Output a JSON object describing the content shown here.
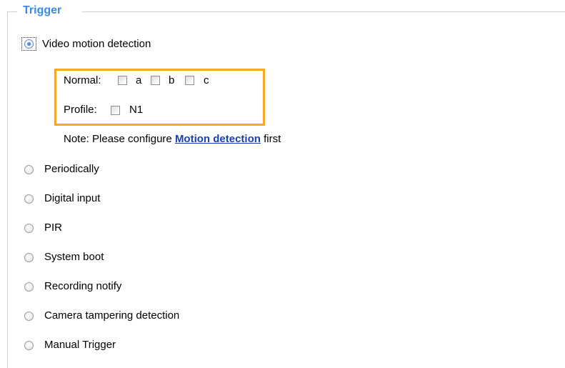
{
  "trigger": {
    "legend": "Trigger",
    "selected": "video_motion_detection",
    "options": {
      "video_motion_detection": "Video motion detection",
      "periodically": "Periodically",
      "digital_input": "Digital input",
      "pir": "PIR",
      "system_boot": "System boot",
      "recording_notify": "Recording notify",
      "camera_tampering_detection": "Camera tampering detection",
      "manual_trigger": "Manual Trigger"
    }
  },
  "motion": {
    "normal_label": "Normal:",
    "windows": [
      "a",
      "b",
      "c"
    ],
    "profile_label": "Profile:",
    "profile_windows": [
      "N1"
    ],
    "note_prefix": "Note: Please configure",
    "note_link": "Motion detection",
    "note_suffix": "first"
  },
  "colors": {
    "legend": "#3d8be0",
    "highlight_border": "#f5a623",
    "link": "#1a3fb5"
  }
}
